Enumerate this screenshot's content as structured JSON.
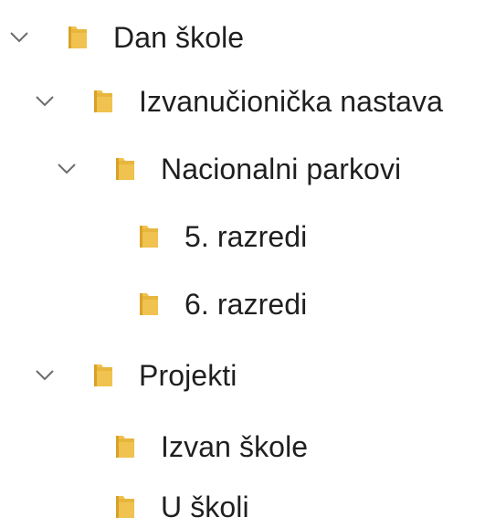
{
  "tree": {
    "items": [
      {
        "label": "Dan škole",
        "expanded": true,
        "icon": "folder-icon"
      },
      {
        "label": "Izvanučionička nastava",
        "expanded": true,
        "icon": "folder-icon"
      },
      {
        "label": "Nacionalni parkovi",
        "expanded": true,
        "icon": "folder-icon"
      },
      {
        "label": "5. razredi",
        "expanded": false,
        "icon": "folder-icon"
      },
      {
        "label": "6. razredi",
        "expanded": false,
        "icon": "folder-icon"
      },
      {
        "label": "Projekti",
        "expanded": true,
        "icon": "folder-icon"
      },
      {
        "label": "Izvan škole",
        "expanded": false,
        "icon": "folder-icon"
      },
      {
        "label": "U školi",
        "expanded": false,
        "icon": "folder-icon"
      }
    ]
  },
  "colors": {
    "folder_main": "#f0c24f",
    "folder_shadow": "#d9a227",
    "chevron": "#6b6b6b",
    "text": "#1f1f1f"
  }
}
